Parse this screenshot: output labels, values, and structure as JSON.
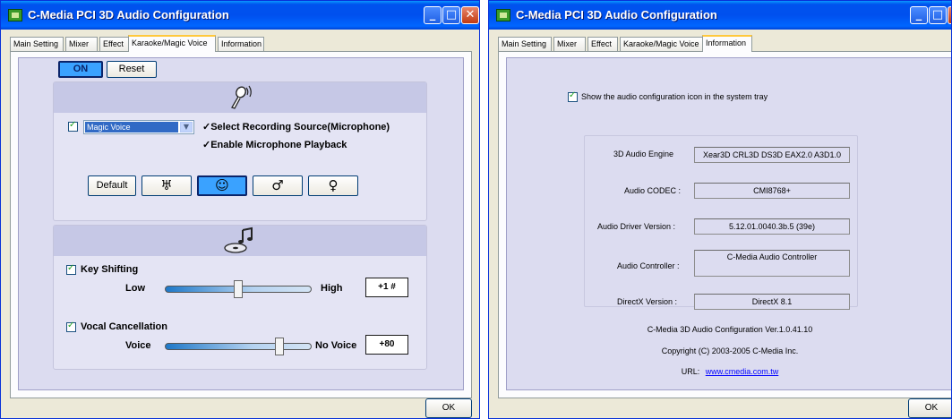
{
  "left_window": {
    "title": "C-Media PCI 3D Audio Configuration",
    "tabs": [
      "Main Setting",
      "Mixer",
      "Effect",
      "Karaoke/Magic Voice",
      "Information"
    ],
    "active_tab": "Karaoke/Magic Voice",
    "on_button": "ON",
    "reset_button": "Reset",
    "magic_voice": {
      "icon": "microphone-icon",
      "selected": "Magic Voice",
      "options": [
        "✓Select Recording Source(Microphone)",
        "✓Enable Microphone Playback"
      ],
      "default_button": "Default",
      "preset_icons": [
        "monster-icon",
        "alien-face-icon",
        "male-symbol-icon",
        "female-symbol-icon"
      ],
      "selected_preset": "alien-face-icon"
    },
    "karaoke": {
      "icon": "music-disc-icon",
      "key_shifting": {
        "label": "Key Shifting",
        "low": "Low",
        "high": "High",
        "value": "+1 #",
        "level": 0.5
      },
      "vocal_cancellation": {
        "label": "Vocal Cancellation",
        "low": "Voice",
        "high": "No Voice",
        "value": "+80",
        "level": 0.8
      }
    },
    "ok_button": "OK"
  },
  "right_window": {
    "title": "C-Media PCI 3D Audio Configuration",
    "tabs": [
      "Main Setting",
      "Mixer",
      "Effect",
      "Karaoke/Magic Voice",
      "Information"
    ],
    "active_tab": "Information",
    "tray_checkbox": "Show the audio configuration icon in the system tray",
    "rows": [
      {
        "label": "3D Audio Engine",
        "value": "Xear3D  CRL3D  DS3D  EAX2.0  A3D1.0"
      },
      {
        "label": "Audio CODEC :",
        "value": "CMI8768+"
      },
      {
        "label": "Audio Driver Version :",
        "value": "5.12.01.0040.3b.5 (39e)"
      },
      {
        "label": "Audio Controller :",
        "value": "C-Media Audio Controller"
      },
      {
        "label": "DirectX Version :",
        "value": "DirectX 8.1"
      }
    ],
    "version_line": "C-Media 3D Audio Configuration Ver.1.0.41.10",
    "copyright": "Copyright (C) 2003-2005 C-Media Inc.",
    "url_label": "URL:",
    "url_link": "www.cmedia.com.tw",
    "ok_button": "OK"
  },
  "colors": {
    "title_bar": "#0050ee",
    "panel_bg": "#dcdcf0",
    "link": "#0000ff",
    "on_button": "#3aa2ff"
  }
}
